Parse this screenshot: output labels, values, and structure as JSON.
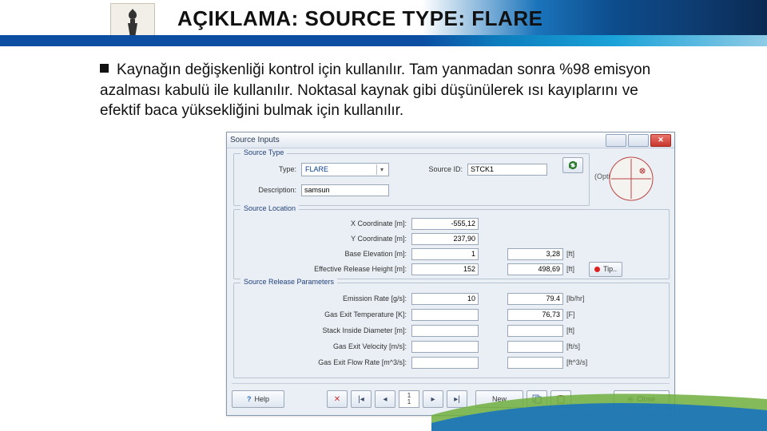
{
  "header": {
    "title": "AÇIKLAMA: SOURCE TYPE: FLARE"
  },
  "bullet": {
    "text": "Kaynağın değişkenliği kontrol için kullanılır. Tam yanmadan sonra %98 emisyon azalması kabulü ile kullanılır. Noktasal kaynak gibi düşünülerek ısı kayıplarını ve efektif baca yüksekliğini bulmak için kullanılır."
  },
  "dialog": {
    "title": "Source Inputs",
    "optional": "(Optional)",
    "source_type": {
      "legend": "Source Type",
      "type_label": "Type:",
      "type_value": "FLARE",
      "source_id_label": "Source ID:",
      "source_id_value": "STCK1",
      "desc_label": "Description:",
      "desc_value": "samsun"
    },
    "source_location": {
      "legend": "Source Location",
      "x_label": "X Coordinate [m]:",
      "x_value": "-555,12",
      "y_label": "Y Coordinate [m]:",
      "y_value": "237,90",
      "base_label": "Base Elevation [m]:",
      "base_value": "1",
      "base_alt": "3,28",
      "base_unit": "[ft]",
      "eff_label": "Effective Release Height [m]:",
      "eff_value": "152",
      "eff_alt": "498,69",
      "eff_unit": "[ft]",
      "tip_label": "Tip.."
    },
    "release": {
      "legend": "Source Release Parameters",
      "emis_label": "Emission Rate [g/s]:",
      "emis_value": "10",
      "emis_alt": "79.4",
      "emis_unit": "[lb/hr]",
      "gas_temp_label": "Gas Exit Temperature [K]:",
      "gas_temp_alt": "76,73",
      "gas_temp_unit": "[F]",
      "stack_d_label": "Stack Inside Diameter [m]:",
      "stack_d_unit": "[ft]",
      "gas_vel_label": "Gas Exit Velocity [m/s]:",
      "gas_vel_unit": "[ft/s]",
      "gas_flow_label": "Gas Exit Flow Rate [m^3/s]:",
      "gas_flow_unit": "[ft^3/s]"
    },
    "toolbar": {
      "help": "Help",
      "page_top": "1",
      "page_bot": "1",
      "new": "New",
      "close": "Close"
    }
  }
}
